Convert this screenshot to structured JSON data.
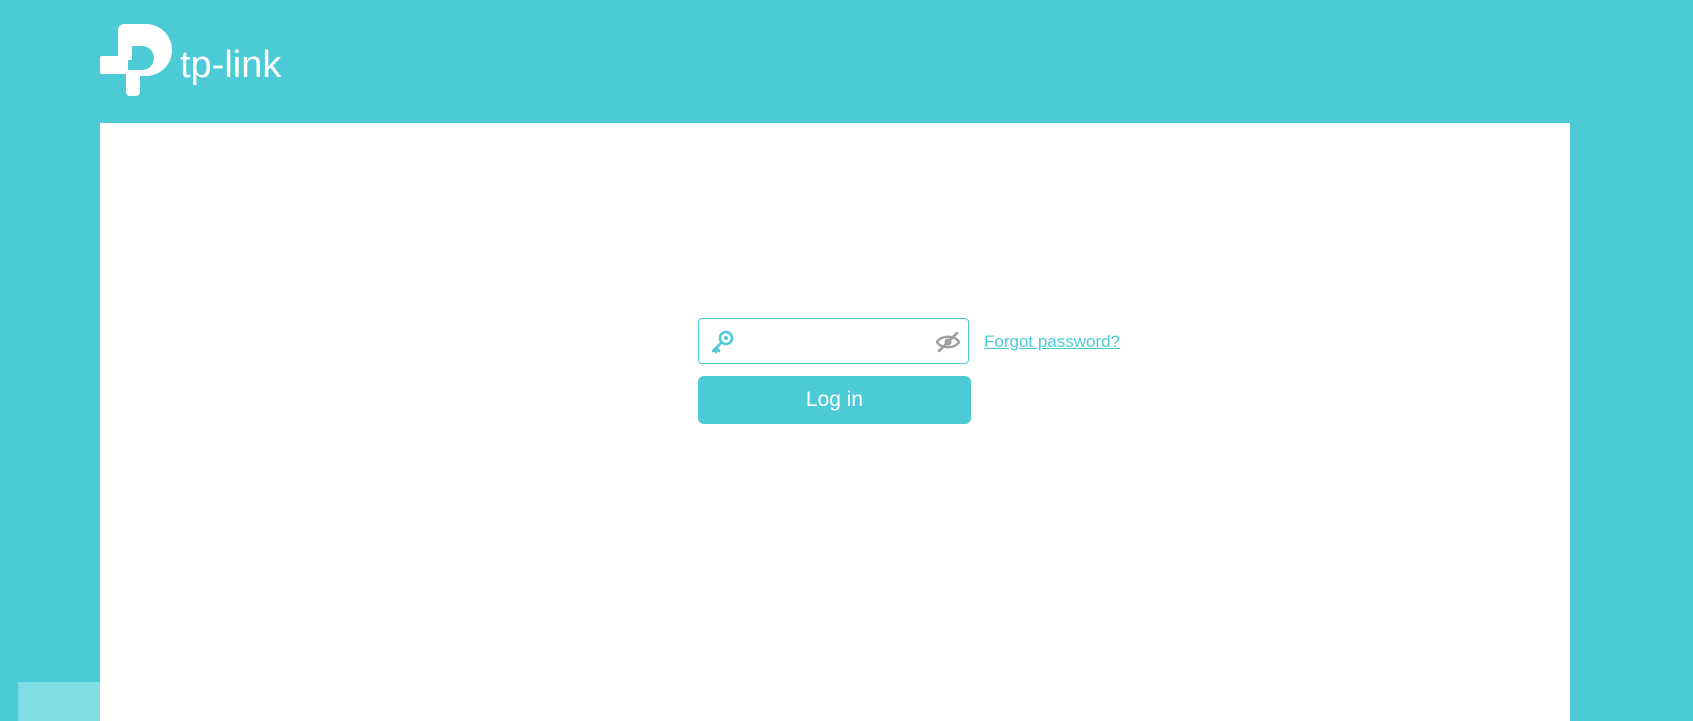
{
  "header": {
    "logo_text": "tp-link",
    "logo_icon": "tp-link-logo-icon"
  },
  "login": {
    "password_value": "",
    "password_placeholder": "",
    "key_icon": "key-icon",
    "toggle_visibility_icon": "eye-slash-icon",
    "forgot_password_label": "Forgot password?",
    "login_button_label": "Log in"
  },
  "colors": {
    "brand": "#4ccbd7",
    "card_background": "#ffffff",
    "eye_icon": "#9e9e9e",
    "bottom_tab": "#7fdde4"
  }
}
